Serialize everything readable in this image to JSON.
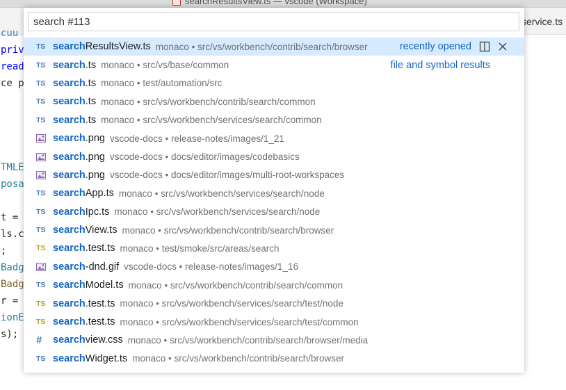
{
  "window": {
    "title": "searchResultsView.ts — vscode (Workspace)",
    "visible_tab": "service.ts"
  },
  "editor_fragments": [
    {
      "text": "cuu",
      "color": "#3b7ab5"
    },
    {
      "text": "priv",
      "color": "#0000ff"
    },
    {
      "text": "read",
      "color": "#0000ff"
    },
    {
      "text": "ce p",
      "color": "#1f1f1f"
    },
    {
      "text": "TMLE",
      "color": "#267f99"
    },
    {
      "text": "posa",
      "color": "#267f99"
    },
    {
      "text": "t = ",
      "color": "#1f1f1f"
    },
    {
      "text": "ls.c",
      "color": "#1f1f1f"
    },
    {
      "text": ";",
      "color": "#1f1f1f"
    },
    {
      "text": "Badg",
      "color": "#267f99"
    },
    {
      "text": "Badg",
      "color": "#795e26"
    },
    {
      "text": "r = ",
      "color": "#1f1f1f"
    },
    {
      "text": "ionE",
      "color": "#267f99"
    },
    {
      "text": "s);",
      "color": "#1f1f1f"
    }
  ],
  "quick_open": {
    "input_value": "search #113",
    "selected_row_side_label": "recently opened",
    "second_row_side_label": "file and symbol results",
    "action_icons": [
      "split-editor-icon",
      "close-icon"
    ],
    "results": [
      {
        "icon": "TS",
        "kind": "ts",
        "hl": "search",
        "rest": "ResultsView.ts",
        "desc": "monaco • src/vs/workbench/contrib/search/browser"
      },
      {
        "icon": "TS",
        "kind": "ts",
        "hl": "search",
        "rest": ".ts",
        "desc": "monaco • src/vs/base/common"
      },
      {
        "icon": "TS",
        "kind": "ts",
        "hl": "search",
        "rest": ".ts",
        "desc": "monaco • test/automation/src"
      },
      {
        "icon": "TS",
        "kind": "ts",
        "hl": "search",
        "rest": ".ts",
        "desc": "monaco • src/vs/workbench/contrib/search/common"
      },
      {
        "icon": "TS",
        "kind": "ts",
        "hl": "search",
        "rest": ".ts",
        "desc": "monaco • src/vs/workbench/services/search/common"
      },
      {
        "icon": "image",
        "kind": "img",
        "hl": "search",
        "rest": ".png",
        "desc": "vscode-docs • release-notes/images/1_21"
      },
      {
        "icon": "image",
        "kind": "img",
        "hl": "search",
        "rest": ".png",
        "desc": "vscode-docs • docs/editor/images/codebasics"
      },
      {
        "icon": "image",
        "kind": "img",
        "hl": "search",
        "rest": ".png",
        "desc": "vscode-docs • docs/editor/images/multi-root-workspaces"
      },
      {
        "icon": "TS",
        "kind": "ts",
        "hl": "search",
        "rest": "App.ts",
        "desc": "monaco • src/vs/workbench/services/search/node"
      },
      {
        "icon": "TS",
        "kind": "ts",
        "hl": "search",
        "rest": "Ipc.ts",
        "desc": "monaco • src/vs/workbench/services/search/node"
      },
      {
        "icon": "TS",
        "kind": "ts",
        "hl": "search",
        "rest": "View.ts",
        "desc": "monaco • src/vs/workbench/contrib/search/browser"
      },
      {
        "icon": "TS",
        "kind": "test",
        "hl": "search",
        "rest": ".test.ts",
        "desc": "monaco • test/smoke/src/areas/search"
      },
      {
        "icon": "image",
        "kind": "img",
        "hl": "search",
        "rest": "-dnd.gif",
        "desc": "vscode-docs • release-notes/images/1_16"
      },
      {
        "icon": "TS",
        "kind": "ts",
        "hl": "search",
        "rest": "Model.ts",
        "desc": "monaco • src/vs/workbench/contrib/search/common"
      },
      {
        "icon": "TS",
        "kind": "test",
        "hl": "search",
        "rest": ".test.ts",
        "desc": "monaco • src/vs/workbench/services/search/test/node"
      },
      {
        "icon": "TS",
        "kind": "test",
        "hl": "search",
        "rest": ".test.ts",
        "desc": "monaco • src/vs/workbench/services/search/test/common"
      },
      {
        "icon": "#",
        "kind": "css",
        "hl": "search",
        "rest": "view.css",
        "desc": "monaco • src/vs/workbench/contrib/search/browser/media"
      },
      {
        "icon": "TS",
        "kind": "ts",
        "hl": "search",
        "rest": "Widget.ts",
        "desc": "monaco • src/vs/workbench/contrib/search/browser"
      }
    ]
  }
}
